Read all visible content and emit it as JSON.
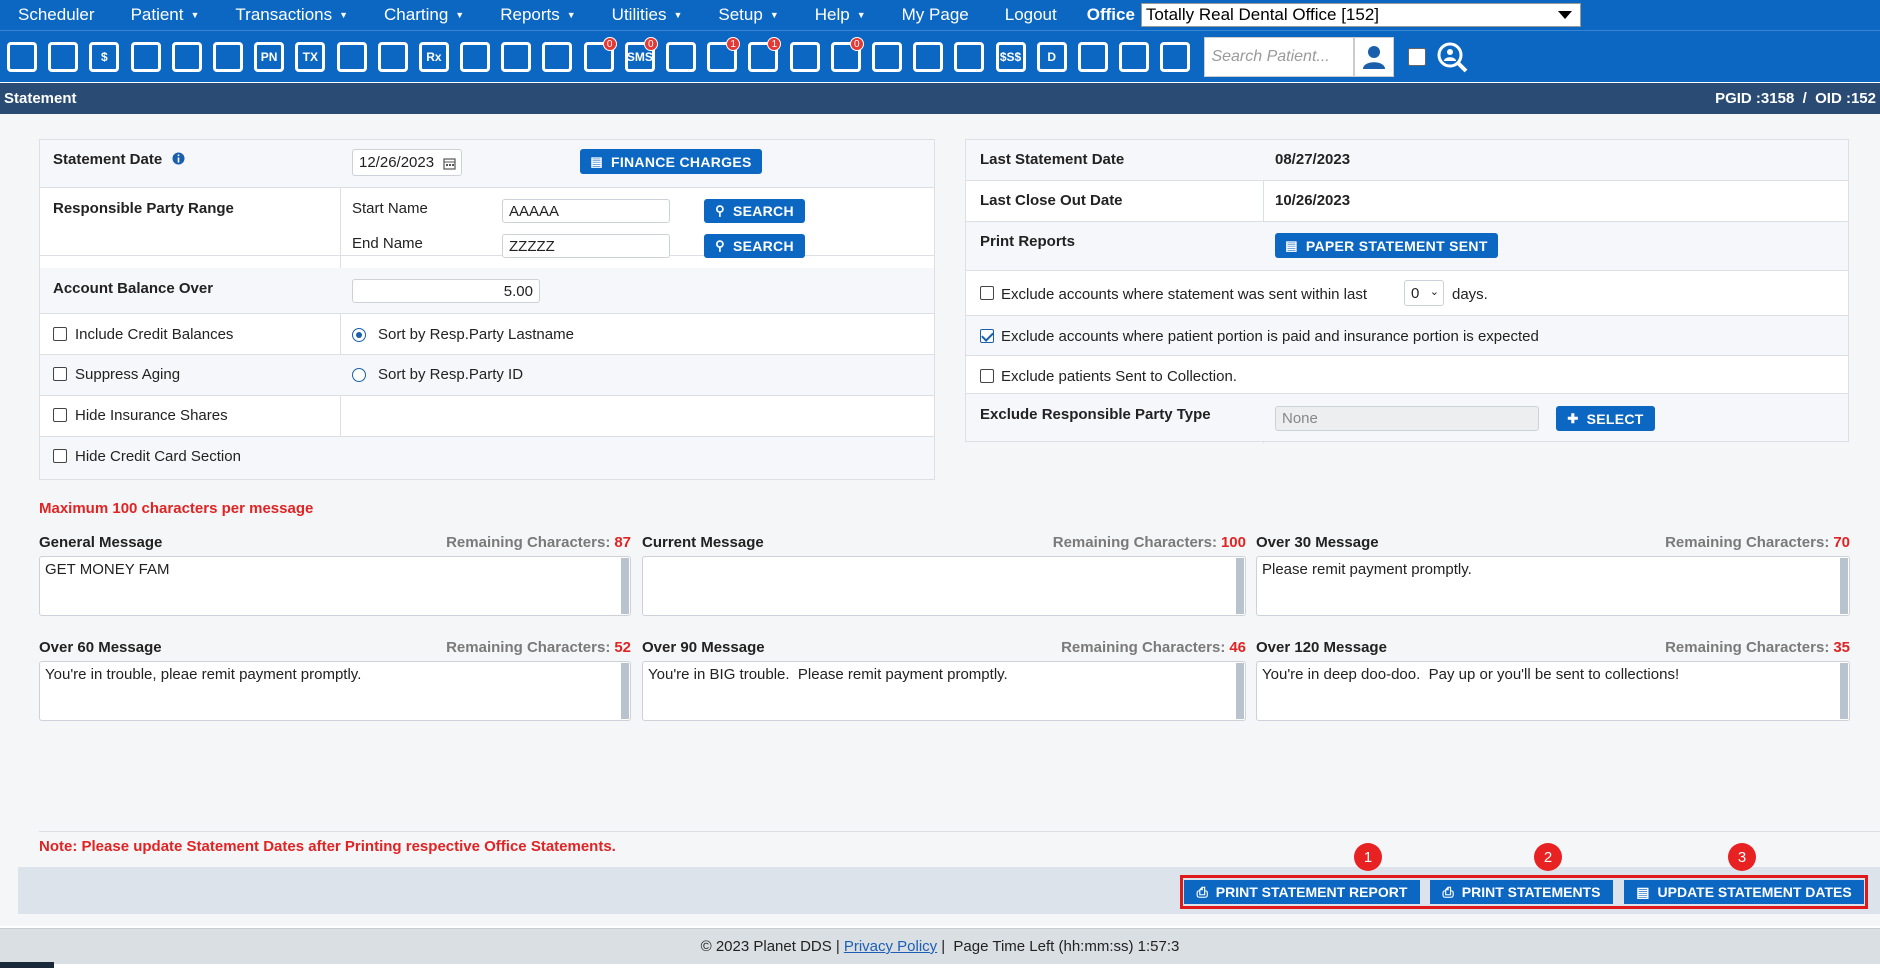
{
  "menu": {
    "items": [
      {
        "label": "Scheduler",
        "caret": false
      },
      {
        "label": "Patient",
        "caret": true
      },
      {
        "label": "Transactions",
        "caret": true
      },
      {
        "label": "Charting",
        "caret": true
      },
      {
        "label": "Reports",
        "caret": true
      },
      {
        "label": "Utilities",
        "caret": true
      },
      {
        "label": "Setup",
        "caret": true
      },
      {
        "label": "Help",
        "caret": true
      },
      {
        "label": "My Page",
        "caret": false
      },
      {
        "label": "Logout",
        "caret": false
      }
    ],
    "office_label": "Office",
    "office_value": "Totally Real Dental Office [152]"
  },
  "toolbar": {
    "icons": [
      {
        "name": "home-icon",
        "text": ""
      },
      {
        "name": "calendar-icon",
        "text": ""
      },
      {
        "name": "finance-icon",
        "text": "$"
      },
      {
        "name": "edit-icon",
        "text": ""
      },
      {
        "name": "tooth-icon",
        "text": ""
      },
      {
        "name": "teeth-icon",
        "text": ""
      },
      {
        "name": "progress-notes-icon",
        "text": "PN"
      },
      {
        "name": "treatment-icon",
        "text": "TX"
      },
      {
        "name": "add-patient-icon",
        "text": ""
      },
      {
        "name": "add-family-icon",
        "text": ""
      },
      {
        "name": "prescription-icon",
        "text": "Rx"
      },
      {
        "name": "notes-icon",
        "text": ""
      },
      {
        "name": "document-icon",
        "text": ""
      },
      {
        "name": "mail-icon",
        "text": ""
      },
      {
        "name": "messages-icon",
        "text": "",
        "badge": "0"
      },
      {
        "name": "sms-icon",
        "text": "SMS",
        "badge": "0"
      },
      {
        "name": "clock-icon",
        "text": ""
      },
      {
        "name": "web-patient-icon",
        "text": "",
        "badge": "1"
      },
      {
        "name": "sync-icon",
        "text": "",
        "badge": "1"
      },
      {
        "name": "globe-icon",
        "text": ""
      },
      {
        "name": "forms-icon",
        "text": "",
        "badge": "0"
      },
      {
        "name": "group-icon",
        "text": ""
      },
      {
        "name": "print-icon",
        "text": ""
      },
      {
        "name": "insurance-forward-icon",
        "text": ""
      },
      {
        "name": "insurance-payment-icon",
        "text": "$S$"
      },
      {
        "name": "daysheet-icon",
        "text": "D"
      },
      {
        "name": "network-icon",
        "text": ""
      },
      {
        "name": "analytics-icon",
        "text": ""
      },
      {
        "name": "collapse-icon",
        "text": ""
      }
    ],
    "search_placeholder": "Search Patient..."
  },
  "header": {
    "title": "Statement",
    "ids": "PGID :3158  /  OID :152"
  },
  "left_form": {
    "statement_date_label": "Statement Date",
    "statement_date_value": "12/26/2023",
    "finance_charges_label": "FINANCE CHARGES",
    "resp_party_range_label": "Responsible Party Range",
    "start_name_label": "Start Name",
    "start_name_value": "AAAAA",
    "end_name_label": "End Name",
    "end_name_value": "ZZZZZ",
    "search_label": "SEARCH",
    "account_balance_label": "Account Balance Over",
    "account_balance_value": "5.00",
    "include_credit_label": "Include Credit Balances",
    "suppress_aging_label": "Suppress Aging",
    "hide_insurance_label": "Hide Insurance Shares",
    "hide_credit_card_label": "Hide Credit Card Section",
    "sort_lastname_label": "Sort by Resp.Party Lastname",
    "sort_id_label": "Sort by Resp.Party ID"
  },
  "right_form": {
    "last_statement_label": "Last Statement Date",
    "last_statement_value": "08/27/2023",
    "last_close_label": "Last Close Out Date",
    "last_close_value": "10/26/2023",
    "print_reports_label": "Print Reports",
    "paper_statement_label": "PAPER STATEMENT SENT",
    "exclude_sent_label": "Exclude accounts where statement was sent within last",
    "exclude_sent_days": "0",
    "days_label": "days.",
    "exclude_paid_label": "Exclude accounts where patient portion is paid and insurance portion is expected",
    "exclude_collection_label": "Exclude patients Sent to Collection.",
    "exclude_resp_type_label": "Exclude Responsible Party Type",
    "exclude_resp_type_value": "None",
    "select_label": "SELECT"
  },
  "messages": {
    "max_note": "Maximum 100 characters per message",
    "remaining_label": "Remaining Characters:",
    "items": [
      {
        "label": "General Message",
        "remaining": "87",
        "text": "GET MONEY FAM"
      },
      {
        "label": "Current Message",
        "remaining": "100",
        "text": ""
      },
      {
        "label": "Over 30 Message",
        "remaining": "70",
        "text": "Please remit payment promptly."
      },
      {
        "label": "Over 60 Message",
        "remaining": "52",
        "text": "You're in trouble, pleae remit payment promptly."
      },
      {
        "label": "Over 90 Message",
        "remaining": "46",
        "text": "You're in BIG trouble.  Please remit payment promptly."
      },
      {
        "label": "Over 120 Message",
        "remaining": "35",
        "text": "You're in deep doo-doo.  Pay up or you'll be sent to collections!"
      }
    ]
  },
  "bottom": {
    "note": "Note: Please update Statement Dates after Printing respective Office Statements.",
    "print_report_label": "PRINT STATEMENT REPORT",
    "print_statements_label": "PRINT STATEMENTS",
    "update_dates_label": "UPDATE STATEMENT DATES",
    "step1": "1",
    "step2": "2",
    "step3": "3"
  },
  "footer": {
    "copyright": "© 2023 Planet DDS |",
    "privacy_label": "Privacy Policy",
    "time_left": "|  Page Time Left (hh:mm:ss) 1:57:3"
  },
  "colors": {
    "brand_blue": "#0b67c2",
    "header_navy": "#2a4b73",
    "alert_red": "#e02424"
  }
}
